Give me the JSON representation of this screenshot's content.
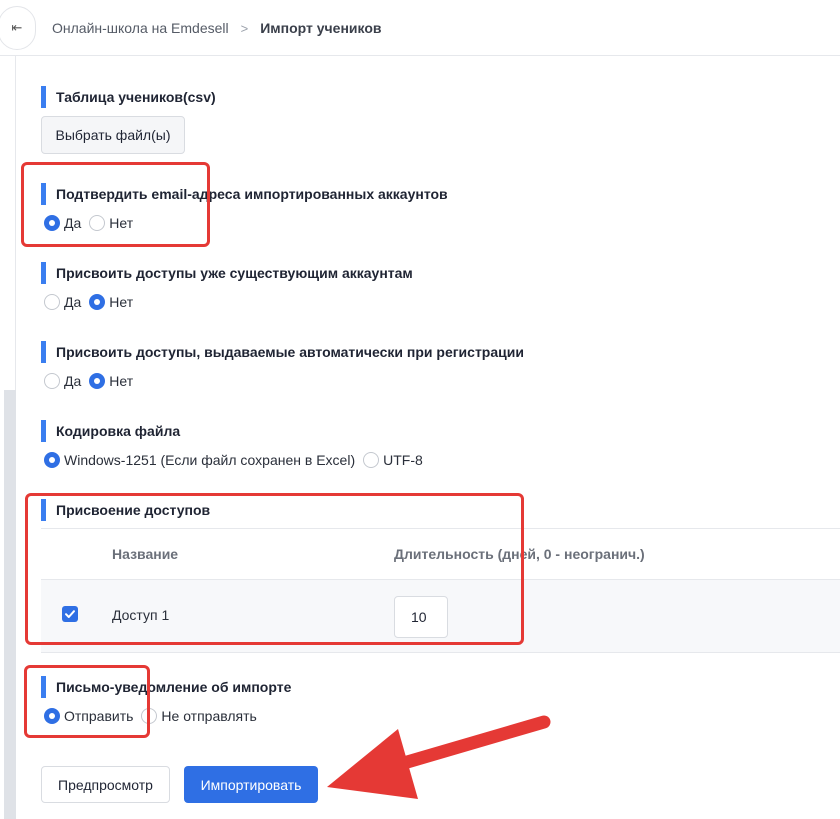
{
  "breadcrumb": {
    "school": "Онлайн-школа на Emdesell",
    "separator": ">",
    "current": "Импорт учеников"
  },
  "icons": {
    "collapse": "sidebar-collapse-icon"
  },
  "csv": {
    "title": "Таблица учеников(csv)",
    "button": "Выбрать файл(ы)"
  },
  "confirm_email": {
    "title": "Подтвердить email-адреса импортированных аккаунтов",
    "options": [
      "Да",
      "Нет"
    ],
    "selected": "Да"
  },
  "assign_existing": {
    "title": "Присвоить доступы уже существующим аккаунтам",
    "options": [
      "Да",
      "Нет"
    ],
    "selected": "Нет"
  },
  "assign_auto": {
    "title": "Присвоить доступы, выдаваемые автоматически при регистрации",
    "options": [
      "Да",
      "Нет"
    ],
    "selected": "Нет"
  },
  "encoding": {
    "title": "Кодировка файла",
    "options": [
      "Windows-1251 (Если файл сохранен в Excel)",
      "UTF-8"
    ],
    "selected": "Windows-1251 (Если файл сохранен в Excel)"
  },
  "access": {
    "title": "Присвоение доступов",
    "col_name": "Название",
    "col_duration": "Длительность (дней, 0 - неогранич.)",
    "rows": [
      {
        "name": "Доступ 1",
        "checked": true,
        "duration": "10"
      }
    ]
  },
  "notify": {
    "title": "Письмо-уведомление об импорте",
    "options": [
      "Отправить",
      "Не отправлять"
    ],
    "selected": "Отправить"
  },
  "actions": {
    "preview": "Предпросмотр",
    "import": "Импортировать"
  },
  "colors": {
    "accent": "#2f6fe4",
    "section_bar": "#3a7ef0",
    "annotation": "#e53935"
  }
}
